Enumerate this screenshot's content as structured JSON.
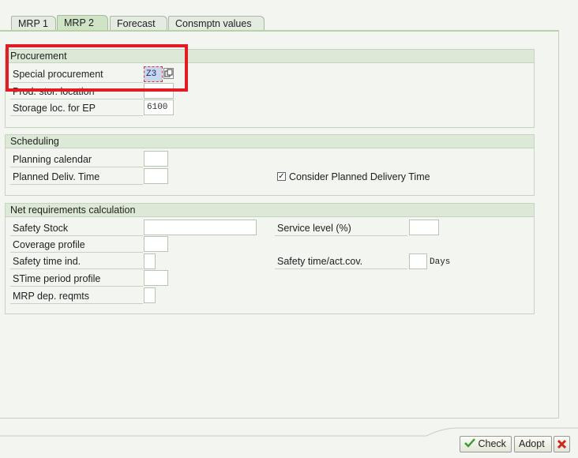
{
  "tabs": [
    "MRP 1",
    "MRP 2",
    "Forecast",
    "Consmptn values"
  ],
  "procurement": {
    "title": "Procurement",
    "special_procurement_label": "Special procurement",
    "special_procurement_value": "Z3",
    "prod_stor_location_label": "Prod. stor. location",
    "storage_loc_ep_label": "Storage loc. for EP",
    "storage_loc_ep_value": "6100"
  },
  "scheduling": {
    "title": "Scheduling",
    "planning_calendar_label": "Planning calendar",
    "planned_deliv_time_label": "Planned Deliv. Time",
    "consider_planned_delivery_label": "Consider Planned Delivery Time",
    "consider_planned_delivery_checked": true
  },
  "net_requirements": {
    "title": "Net requirements calculation",
    "safety_stock_label": "Safety Stock",
    "service_level_label": "Service level (%)",
    "coverage_profile_label": "Coverage profile",
    "safety_time_ind_label": "Safety time ind.",
    "safety_time_act_cov_label": "Safety time/act.cov.",
    "days_unit": "Days",
    "stime_period_profile_label": "STime period profile",
    "mrp_dep_reqmts_label": "MRP dep. reqmts"
  },
  "footer": {
    "check_label": "Check",
    "adopt_label": "Adopt",
    "check_icon": "check-icon",
    "cancel_icon": "close-icon"
  },
  "colors": {
    "highlight": "#e31c23",
    "active_tab": "#cfe3c5"
  }
}
